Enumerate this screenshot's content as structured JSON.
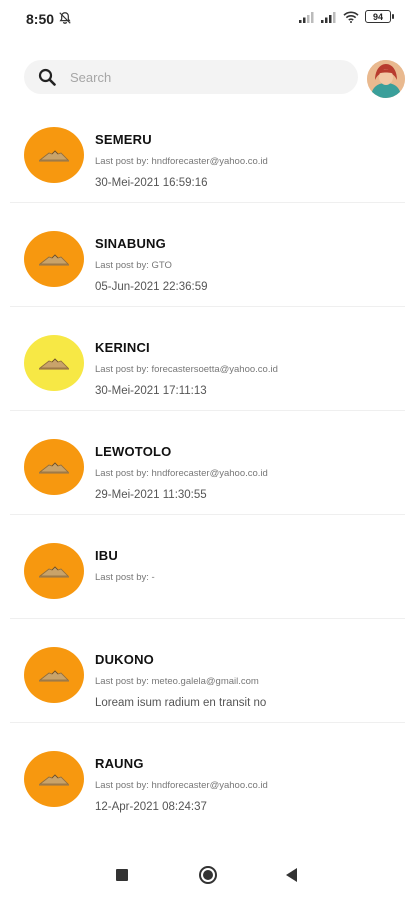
{
  "status_bar": {
    "time": "8:50",
    "battery": "94",
    "icons": [
      "notifications-muted-icon",
      "signal-icon",
      "signal-icon",
      "wifi-icon",
      "battery-icon"
    ]
  },
  "search": {
    "placeholder": "Search",
    "value": ""
  },
  "colors": {
    "orange": "#F7980F",
    "yellow": "#F7E845",
    "divider": "#efefef"
  },
  "list": [
    {
      "title": "SEMERU",
      "last_post": "Last post by: hndforecaster@yahoo.co.id",
      "date": "30-Mei-2021 16:59:16",
      "icon_color": "#F7980F"
    },
    {
      "title": "SINABUNG",
      "last_post": "Last post by: GTO",
      "date": "05-Jun-2021 22:36:59",
      "icon_color": "#F7980F"
    },
    {
      "title": "KERINCI",
      "last_post": "Last post by: forecastersoetta@yahoo.co.id",
      "date": "30-Mei-2021 17:11:13",
      "icon_color": "#F7E845"
    },
    {
      "title": "LEWOTOLO",
      "last_post": "Last post by: hndforecaster@yahoo.co.id",
      "date": "29-Mei-2021 11:30:55",
      "icon_color": "#F7980F"
    },
    {
      "title": "IBU",
      "last_post": "Last post by: -",
      "date": "",
      "icon_color": "#F7980F"
    },
    {
      "title": "DUKONO",
      "last_post": "Last post by: meteo.galela@gmail.com",
      "date": "Loream isum radium en transit no",
      "icon_color": "#F7980F"
    },
    {
      "title": "RAUNG",
      "last_post": "Last post by: hndforecaster@yahoo.co.id",
      "date": "12-Apr-2021 08:24:37",
      "icon_color": "#F7980F"
    }
  ],
  "nav_bar": {
    "buttons": [
      "recents-square-icon",
      "home-circle-icon",
      "back-triangle-icon"
    ]
  }
}
